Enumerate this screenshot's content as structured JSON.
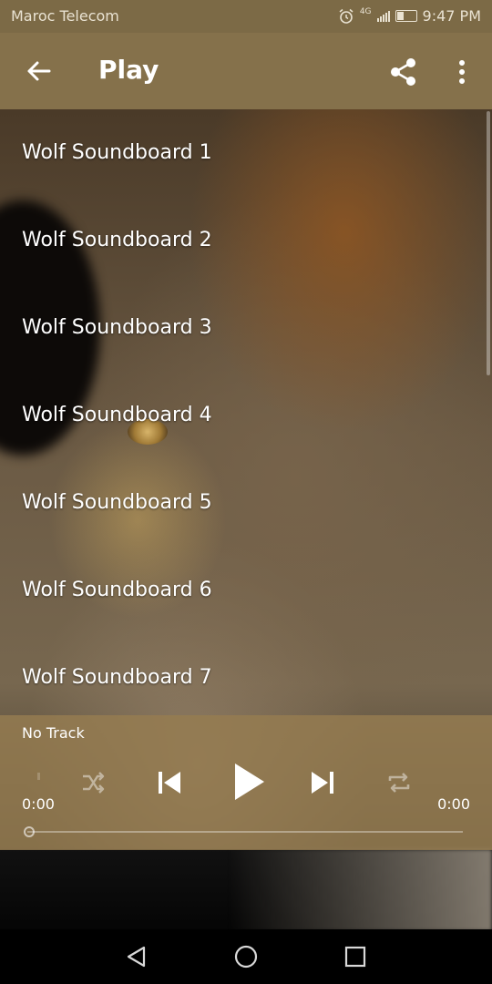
{
  "status": {
    "carrier": "Maroc Telecom",
    "network": "4G",
    "time": "9:47 PM"
  },
  "appbar": {
    "title": "Play"
  },
  "list": {
    "items": [
      "Wolf Soundboard 1",
      "Wolf Soundboard 2",
      "Wolf Soundboard 3",
      "Wolf Soundboard 4",
      "Wolf Soundboard 5",
      "Wolf Soundboard 6",
      "Wolf Soundboard 7"
    ]
  },
  "player": {
    "track": "No Track",
    "elapsed": "0:00",
    "duration": "0:00",
    "progress": 0
  },
  "colors": {
    "status_bar": "#7c6a46",
    "app_bar": "#85714b",
    "player_bg": "#967d50"
  }
}
